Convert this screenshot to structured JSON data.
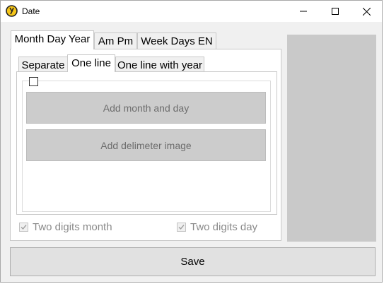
{
  "window": {
    "title": "Date"
  },
  "outer_tabs": [
    {
      "label": "Month Day Year",
      "active": true
    },
    {
      "label": "Am Pm",
      "active": false
    },
    {
      "label": "Week Days EN",
      "active": false
    }
  ],
  "inner_tabs": [
    {
      "label": "Separate",
      "active": false
    },
    {
      "label": "One line",
      "active": true
    },
    {
      "label": "One line with year",
      "active": false
    }
  ],
  "group": {
    "checkbox_checked": false
  },
  "buttons": {
    "add_month_day": "Add month and day",
    "add_delimeter": "Add delimeter image",
    "save": "Save"
  },
  "options": {
    "two_digits_month": {
      "label": "Two digits month",
      "checked": true,
      "enabled": false
    },
    "two_digits_day": {
      "label": "Two digits day",
      "checked": true,
      "enabled": false
    }
  },
  "colors": {
    "preview_background": "#c9c9c9",
    "button_gray": "#cccccc"
  }
}
